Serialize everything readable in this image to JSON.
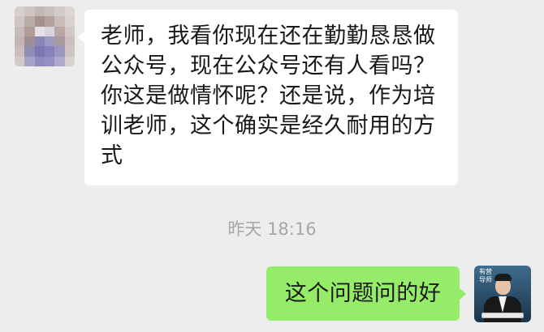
{
  "messages": [
    {
      "direction": "incoming",
      "text": "老师，我看你现在还在勤勤恳恳做公众号，现在公众号还有人看吗？你这是做情怀呢？还是说，作为培训老师，这个确实是经久耐用的方式",
      "avatar": "blurred-profile-photo"
    },
    {
      "direction": "outgoing",
      "text": "这个问题问的好",
      "avatar": "presenter-profile-photo",
      "avatar_badge": "有营 导师"
    }
  ],
  "timestamp": "昨天 18:16",
  "colors": {
    "chat_background": "#ededed",
    "incoming_bubble": "#ffffff",
    "outgoing_bubble": "#95ec69",
    "timestamp_text": "#a6a6a6",
    "message_text": "#191919"
  }
}
